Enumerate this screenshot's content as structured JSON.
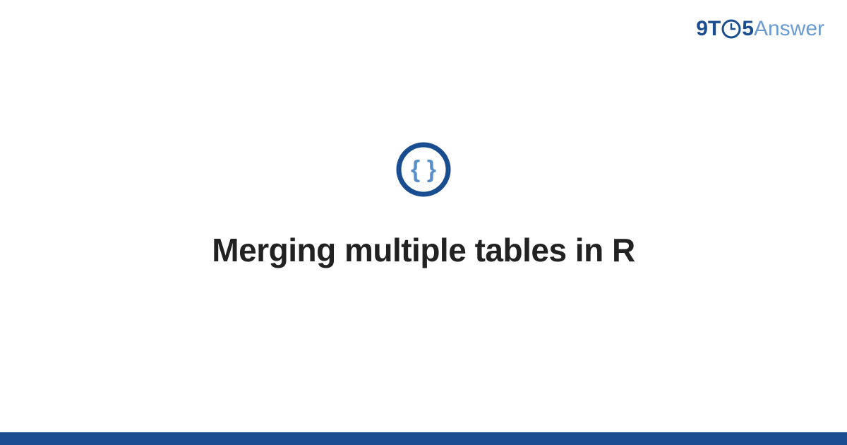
{
  "header": {
    "logo_pre": "9T",
    "logo_post": "5",
    "logo_answer": "Answer"
  },
  "main": {
    "title": "Merging multiple tables in R"
  },
  "colors": {
    "primary_dark": "#1a4d8f",
    "primary_light": "#6b9bd1",
    "text": "#222222"
  }
}
